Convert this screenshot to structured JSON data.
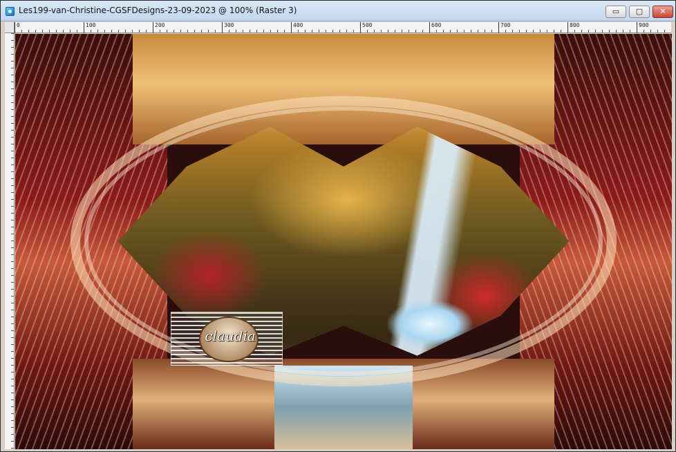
{
  "window": {
    "title": "Les199-van-Christine-CGSFDesigns-23-09-2023 @ 100% (Raster 3)",
    "controls": {
      "minimize": "▭",
      "maximize": "▢",
      "close": "✕"
    }
  },
  "ruler": {
    "top_labels": [
      "0",
      "100",
      "200",
      "300",
      "400",
      "500",
      "600",
      "700",
      "800",
      "900"
    ]
  },
  "canvas": {
    "watermark_text": "claudia"
  },
  "colors": {
    "title_bar": "#c9dbf1",
    "close_button": "#c9463a"
  }
}
